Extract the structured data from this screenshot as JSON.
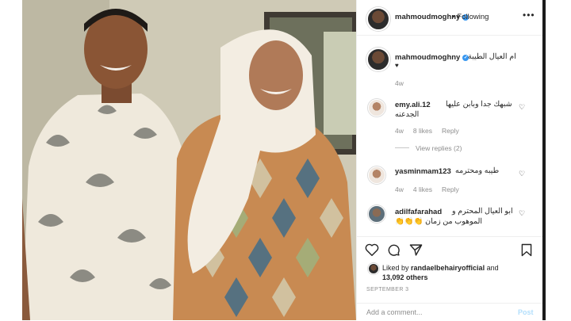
{
  "post": {
    "author": "mahmoudmoghny",
    "follow_status": "Following",
    "more_label": "•••",
    "caption": "ام العيال الطيبة",
    "caption_extra": "♥",
    "caption_age": "4w"
  },
  "comments": [
    {
      "user": "emy.ali.12",
      "text_line1": "شبهك جدا وبابن عليها",
      "text_line2": "الجدعنه",
      "age": "4w",
      "likes": "8 likes",
      "reply": "Reply",
      "replies": "View replies (2)"
    },
    {
      "user": "yasminmam123",
      "text_line1": "طيبه ومحترمه",
      "text_line2": "",
      "age": "4w",
      "likes": "4 likes",
      "reply": "Reply"
    },
    {
      "user": "adilfafarahad",
      "text_line1": "ابو العيال المحترم و",
      "text_line2": "الموهوب من زمان 👏👏👏",
      "age": "",
      "likes": "",
      "reply": ""
    }
  ],
  "likes": {
    "prefix": "Liked by ",
    "user": "randaelbehairyofficial",
    "middle": " and",
    "count": "13,092 others"
  },
  "date": "SEPTEMBER 3",
  "comment_box": {
    "placeholder": "Add a comment...",
    "post_label": "Post"
  },
  "icons": {
    "like": "heart-icon",
    "comment": "comment-icon",
    "share": "share-icon",
    "save": "bookmark-icon",
    "verified": "verified-badge-icon"
  },
  "colors": {
    "accent": "#3897f0",
    "muted": "#8e8e8e",
    "post_disabled": "#b2dffc"
  }
}
